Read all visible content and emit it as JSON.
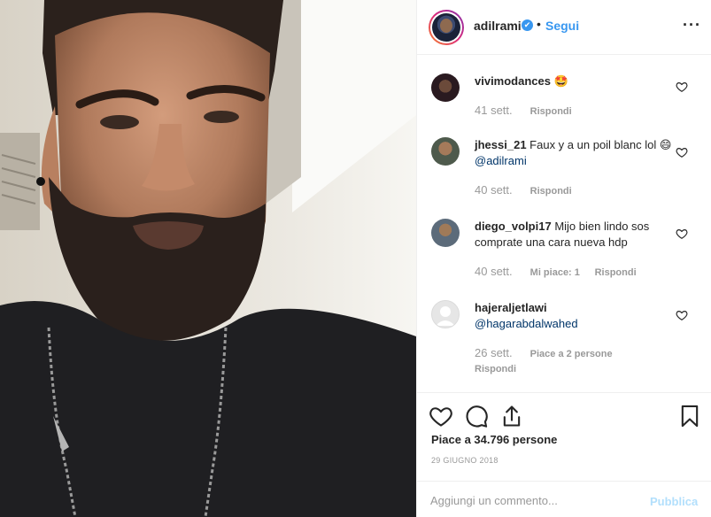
{
  "post": {
    "username": "adilrami",
    "verified_mark": "✔",
    "separator": "•",
    "follow_label": "Segui",
    "more_label": "···"
  },
  "comments": [
    {
      "user": "vivimodances",
      "text": "🤩",
      "time": "41 sett.",
      "likes_label": "",
      "reply_label": "Rispondi"
    },
    {
      "user": "jhessi_21",
      "text": "Faux y a un poil blanc lol 😄",
      "mention": "@adilrami",
      "time": "40 sett.",
      "likes_label": "",
      "reply_label": "Rispondi"
    },
    {
      "user": "diego_volpi17",
      "text": "Mijo bien lindo sos comprate una cara nueva hdp",
      "time": "40 sett.",
      "likes_label": "Mi piace: 1",
      "reply_label": "Rispondi"
    },
    {
      "user": "hajeraljetlawi",
      "text": "",
      "mention": "@hagarabdalwahed",
      "time": "26 sett.",
      "likes_label": "Piace a 2 persone",
      "reply_label": "Rispondi"
    }
  ],
  "likes_text": "Piace a 34.796 persone",
  "date_text": "29 GIUGNO 2018",
  "comment_box": {
    "placeholder": "Aggiungi un commento...",
    "publish_label": "Pubblica"
  },
  "icons": {
    "like": "heart-icon",
    "comment": "comment-icon",
    "share": "share-icon",
    "save": "bookmark-icon",
    "comment_like": "heart-icon"
  },
  "colors": {
    "link": "#3897f0",
    "muted": "#999999",
    "text": "#262626",
    "publish_disabled": "#b2dffc"
  }
}
